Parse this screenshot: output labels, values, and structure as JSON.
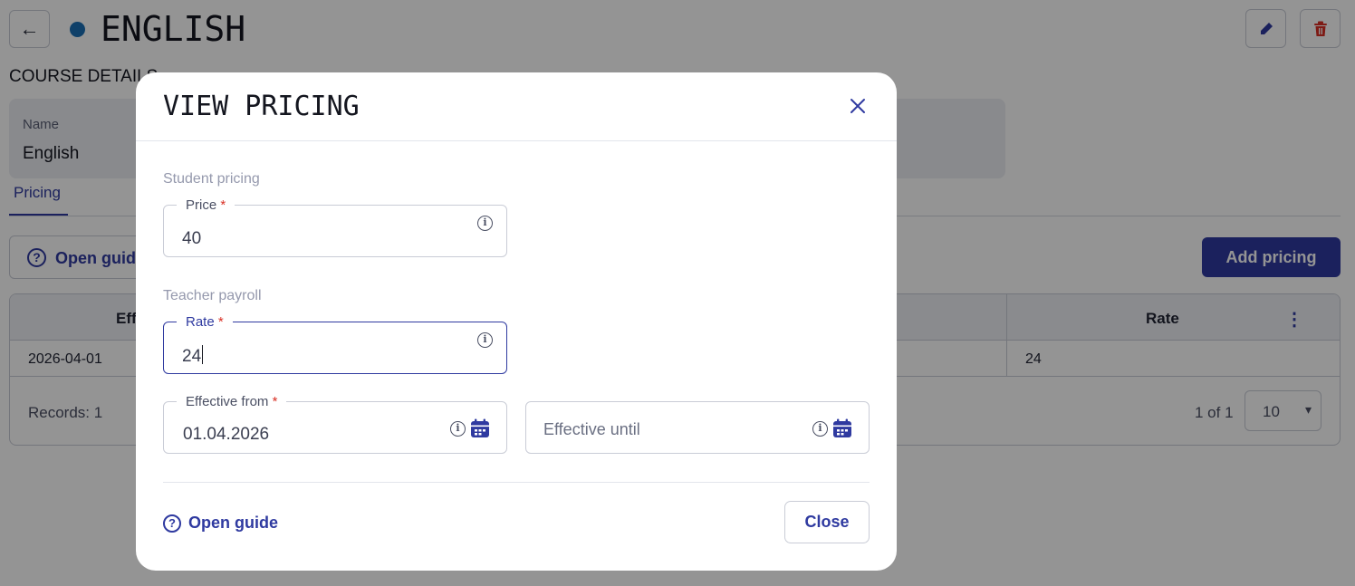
{
  "header": {
    "back_glyph": "←",
    "title": "ENGLISH",
    "status_color": "#1a6fb5"
  },
  "course_details": {
    "section_label": "COURSE DETAILS",
    "name_label": "Name",
    "name_value": "English"
  },
  "tabs": [
    {
      "label": "Pricing",
      "active": true
    }
  ],
  "toolbar": {
    "guide_label": "Open guide",
    "add_label": "Add pricing"
  },
  "table": {
    "columns": [
      "Eff",
      "Rate"
    ],
    "rows": [
      {
        "effective": "2026-04-01",
        "rate": "24"
      }
    ],
    "records_label": "Records: 1",
    "pagination": "1 of 1",
    "per_page": "10"
  },
  "modal": {
    "title": "VIEW PRICING",
    "student_group": "Student pricing",
    "price_label": "Price",
    "price_value": "40",
    "teacher_group": "Teacher payroll",
    "rate_label": "Rate",
    "rate_value": "24",
    "effective_from_label": "Effective from",
    "effective_from_value": "01.04.2026",
    "effective_until_placeholder": "Effective until",
    "required_mark": "*",
    "info_glyph": "i",
    "guide_label": "Open guide",
    "close_label": "Close"
  },
  "colors": {
    "accent": "#2f3aa0",
    "required": "#d93025",
    "delete": "#d93025"
  },
  "icons": [
    "back-arrow-icon",
    "edit-icon",
    "trash-icon",
    "help-circle-icon",
    "kebab-menu-icon",
    "close-icon",
    "info-icon",
    "calendar-icon",
    "chevron-down-icon"
  ]
}
